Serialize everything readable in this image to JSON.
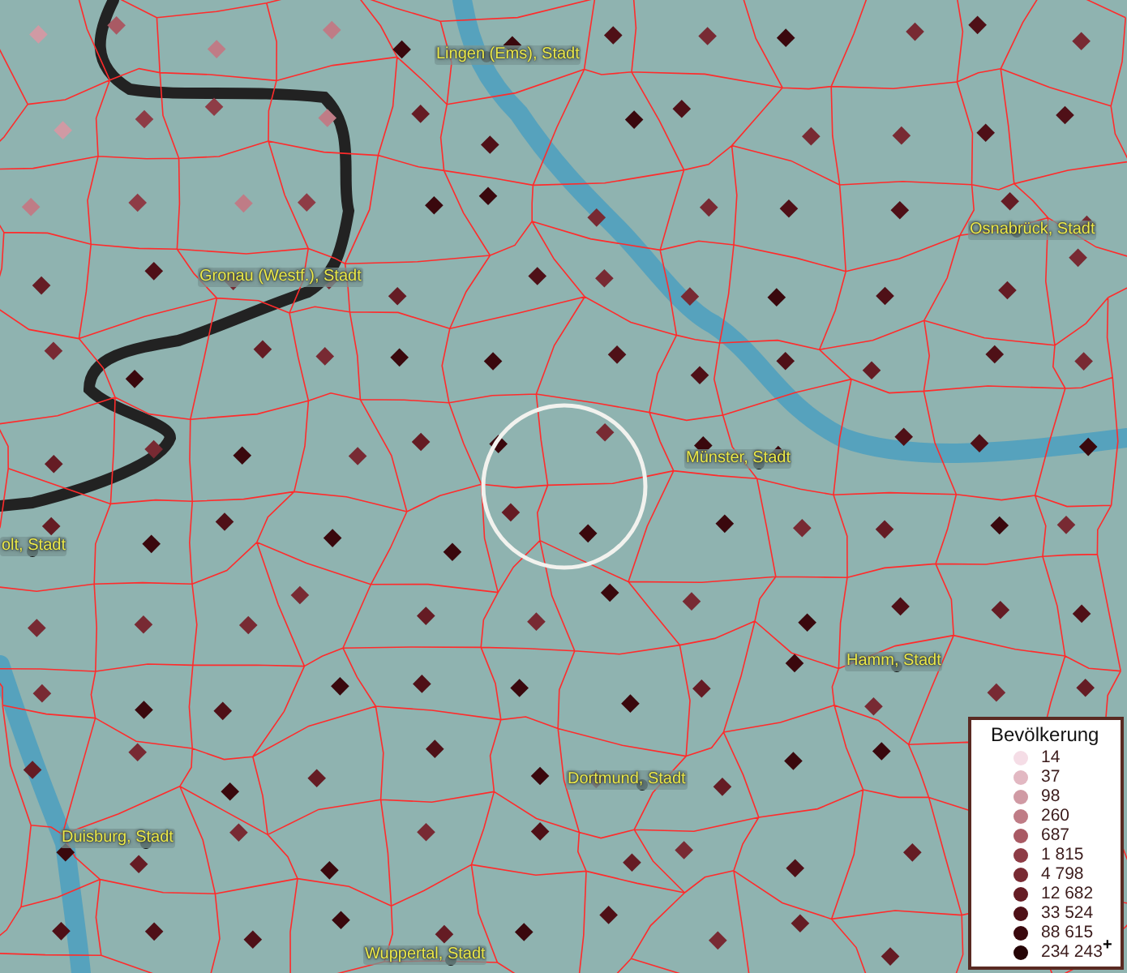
{
  "map": {
    "labels": [
      {
        "text": "Lingen (Ems), Stadt"
      },
      {
        "text": "Osnabrück, Stadt"
      },
      {
        "text": "Gronau (Westf.), Stadt"
      },
      {
        "text": "Münster, Stadt"
      },
      {
        "text": "olt, Stadt"
      },
      {
        "text": "Hamm, Stadt"
      },
      {
        "text": "Dortmund, Stadt"
      },
      {
        "text": "Duisburg, Stadt"
      },
      {
        "text": "Wuppertal, Stadt"
      }
    ]
  },
  "legend": {
    "title": "Bevölkerung",
    "items": [
      {
        "label": "14",
        "color": "#f5dde6"
      },
      {
        "label": "37",
        "color": "#e2b8c2"
      },
      {
        "label": "98",
        "color": "#d09aa4"
      },
      {
        "label": "260",
        "color": "#bf7c86"
      },
      {
        "label": "687",
        "color": "#a95a64"
      },
      {
        "label": "1 815",
        "color": "#8e3c46"
      },
      {
        "label": "4 798",
        "color": "#782a33"
      },
      {
        "label": "12 682",
        "color": "#651c24"
      },
      {
        "label": "33 524",
        "color": "#4f1017"
      },
      {
        "label": "88 615",
        "color": "#3a080d"
      },
      {
        "label": "234 243$^{+}$",
        "color": "#250406"
      }
    ]
  }
}
